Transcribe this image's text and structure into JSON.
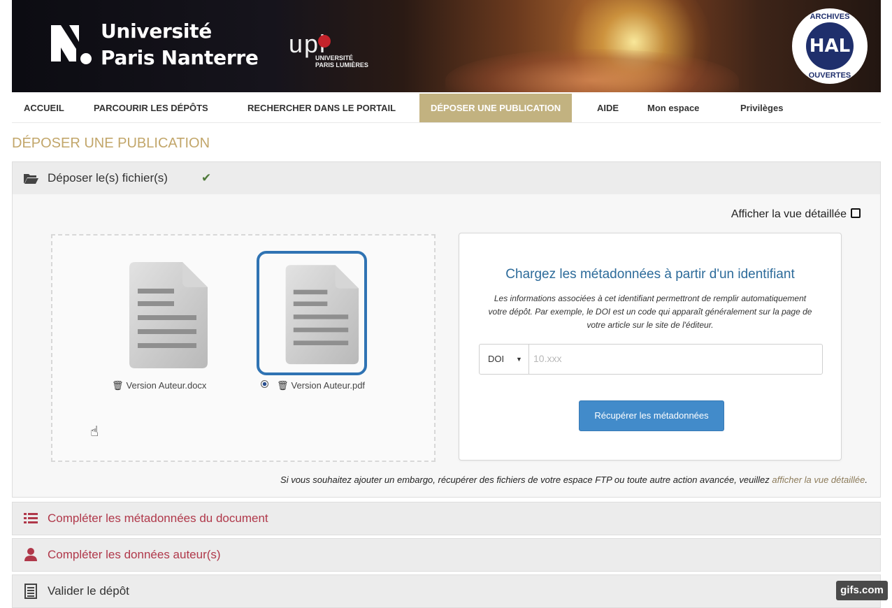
{
  "banner": {
    "university_line1": "Université",
    "university_line2": "Paris Nanterre",
    "upl_letters": "upl",
    "upl_line1": "UNIVERSITÉ",
    "upl_line2": "PARIS LUMIÈRES",
    "hal_top": "ARCHIVES",
    "hal_center": "HAL",
    "hal_bottom": "OUVERTES"
  },
  "nav": {
    "items": [
      {
        "label": "ACCUEIL"
      },
      {
        "label": "PARCOURIR LES DÉPÔTS"
      },
      {
        "label": "RECHERCHER DANS LE PORTAIL"
      },
      {
        "label": "DÉPOSER UNE PUBLICATION",
        "active": true
      },
      {
        "label": "AIDE"
      },
      {
        "label": "Mon espace"
      },
      {
        "label": "Privilèges"
      }
    ]
  },
  "page_title": "DÉPOSER UNE PUBLICATION",
  "sections": {
    "files": {
      "label": "Déposer le(s) fichier(s)",
      "status": "✔"
    },
    "metadata": {
      "label": "Compléter les métadonnées du document"
    },
    "authors": {
      "label": "Compléter les données auteur(s)"
    },
    "validate": {
      "label": "Valider le dépôt"
    }
  },
  "detail_toggle": "Afficher la vue détaillée",
  "files": [
    {
      "name": "Version Auteur.docx",
      "selected": false
    },
    {
      "name": "Version Auteur.pdf",
      "selected": true
    }
  ],
  "metadata_box": {
    "title": "Chargez les métadonnées à partir d'un identifiant",
    "description": "Les informations associées à cet identifiant permettront de remplir automatiquement votre dépôt. Par exemple, le DOI est un code qui apparaît généralement sur la page de votre article sur le site de l'éditeur.",
    "id_type": "DOI",
    "id_placeholder": "10.xxx",
    "fetch_button": "Récupérer les métadonnées"
  },
  "advanced_note": {
    "text": "Si vous souhaitez ajouter un embargo, récupérer des fichiers de votre espace FTP ou toute autre action avancée, veuillez ",
    "link": "afficher la vue détaillée",
    "end": "."
  },
  "watermark": "gifs.com",
  "colors": {
    "accent_gold": "#c2b280",
    "title_gold": "#c2a66a",
    "link_blue": "#2d6b9a",
    "button_blue": "#428bca",
    "section_red": "#b0384a",
    "hal_blue": "#1f2f6c"
  }
}
